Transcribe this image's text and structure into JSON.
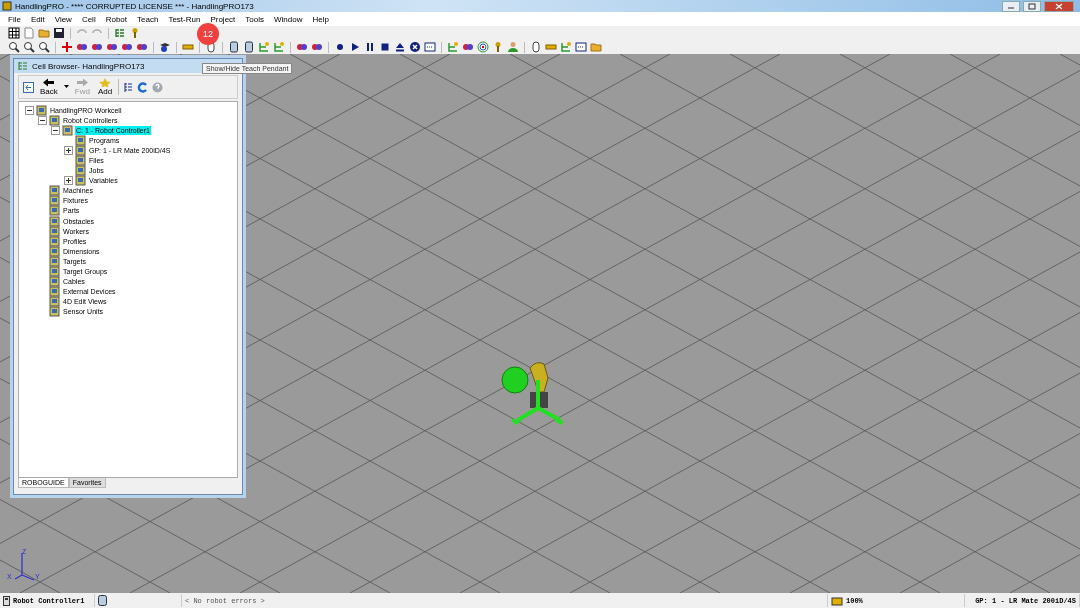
{
  "window": {
    "title": "HandlingPRO - **** CORRUPTED LICENSE *** - HandlingPRO173"
  },
  "menu": [
    "File",
    "Edit",
    "View",
    "Cell",
    "Robot",
    "Teach",
    "Test-Run",
    "Project",
    "Tools",
    "Window",
    "Help"
  ],
  "annotation_badge": "12",
  "tooltip": "Show/Hide Teach Pendant",
  "cell_browser": {
    "title": "Cell Browser- HandlingPRO173",
    "nav_buttons": [
      {
        "label": "Back",
        "disabled": false
      },
      {
        "label": "Fwd",
        "disabled": true
      },
      {
        "label": "Add",
        "disabled": false
      }
    ],
    "tree": [
      {
        "label": "HandlingPRO Workcell",
        "expanded": true,
        "selected": false,
        "children": [
          {
            "label": "Robot Controllers",
            "expanded": true,
            "selected": false,
            "children": [
              {
                "label": "C: 1 - Robot Controller1",
                "expanded": true,
                "selected": true,
                "children": [
                  {
                    "label": "Programs",
                    "selected": false
                  },
                  {
                    "label": "GP: 1 - LR Mate 200iD/4S",
                    "expanded": false,
                    "selected": false
                  },
                  {
                    "label": "Files",
                    "selected": false
                  },
                  {
                    "label": "Jobs",
                    "selected": false
                  },
                  {
                    "label": "Variables",
                    "expanded": false,
                    "selected": false
                  }
                ]
              }
            ]
          },
          {
            "label": "Machines",
            "selected": false
          },
          {
            "label": "Fixtures",
            "selected": false
          },
          {
            "label": "Parts",
            "selected": false
          },
          {
            "label": "Obstacles",
            "selected": false
          },
          {
            "label": "Workers",
            "selected": false
          },
          {
            "label": "Profiles",
            "selected": false
          },
          {
            "label": "Dimensions",
            "selected": false
          },
          {
            "label": "Targets",
            "selected": false
          },
          {
            "label": "Target Groups",
            "selected": false
          },
          {
            "label": "Cables",
            "selected": false
          },
          {
            "label": "External Devices",
            "selected": false
          },
          {
            "label": "4D Edit Views",
            "selected": false
          },
          {
            "label": "Sensor Units",
            "selected": false
          }
        ]
      }
    ],
    "tabs": [
      {
        "label": "ROBOGUIDE",
        "selected": true
      },
      {
        "label": "Favorites",
        "selected": false
      }
    ]
  },
  "viewport": {
    "axis_labels": [
      "Z",
      "X",
      "Y"
    ]
  },
  "status_bar": {
    "controller": "Robot Controller1",
    "errors": "< No robot errors >",
    "zoom": "100%",
    "group": "GP: 1 - LR Mate 200iD/4S"
  }
}
